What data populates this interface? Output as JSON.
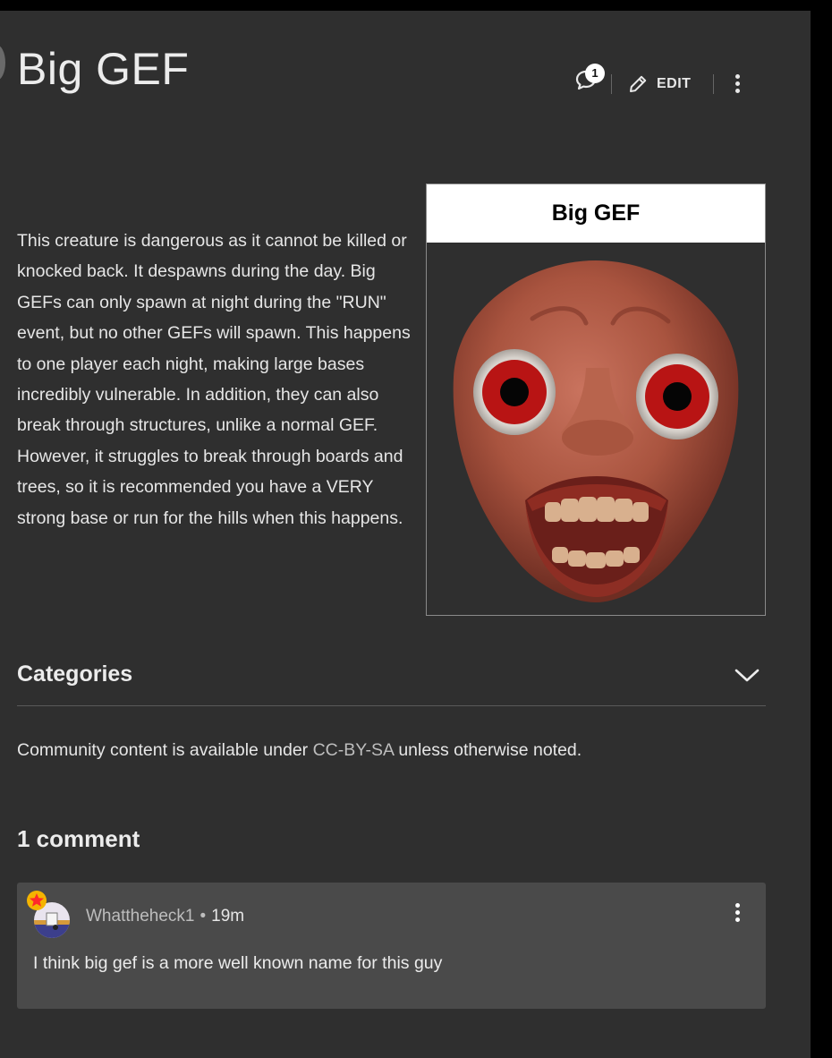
{
  "page": {
    "title": "Big GEF",
    "comment_count_badge": "1",
    "edit_label": "EDIT",
    "body": "This creature is dangerous as it cannot be killed or knocked back. It despawns during the day. Big GEFs can only spawn at night during the \"RUN\" event, but no other GEFs will spawn. This happens to one player each night, making large bases incredibly vulnerable. In addition, they can also break through structures, unlike a normal GEF. However, it struggles to break through boards and trees, so it is recommended you have a VERY strong base or run for the hills when this happens."
  },
  "infobox": {
    "title": "Big GEF"
  },
  "categories": {
    "label": "Categories"
  },
  "license": {
    "prefix": "Community content is available under ",
    "link": "CC-BY-SA",
    "suffix": " unless otherwise noted."
  },
  "comments": {
    "heading": "1 comment",
    "items": [
      {
        "author": "Whattheheck1",
        "time": "19m",
        "text": "I think big gef is a more well known name for this guy"
      }
    ]
  },
  "colors": {
    "page_bg": "#2f2f2f",
    "card_bg": "#4a4a4a",
    "infobox_header_bg": "#ffffff",
    "muted_text": "#bdbdbd",
    "badge_star": "#ff2a2a"
  },
  "icons": [
    "comment-bubble-icon",
    "pencil-icon",
    "more-vertical-icon",
    "chevron-down-icon",
    "avatar-icon",
    "star-badge-icon"
  ]
}
